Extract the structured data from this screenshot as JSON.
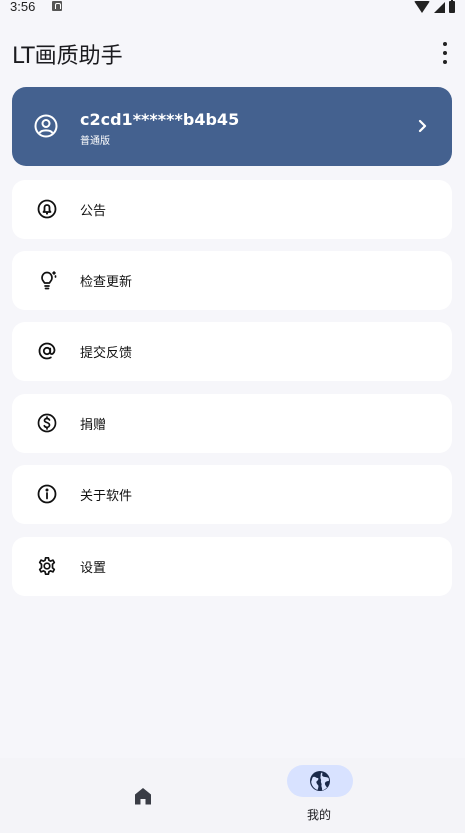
{
  "status_bar": {
    "time": "3:56"
  },
  "header": {
    "title": "LT画质助手"
  },
  "account": {
    "id": "c2cd1******b4b45",
    "tier": "普通版"
  },
  "menu": [
    {
      "label": "公告",
      "icon": "bell-icon"
    },
    {
      "label": "检查更新",
      "icon": "lightbulb-icon"
    },
    {
      "label": "提交反馈",
      "icon": "at-sign-icon"
    },
    {
      "label": "捐赠",
      "icon": "dollar-icon"
    },
    {
      "label": "关于软件",
      "icon": "info-icon"
    },
    {
      "label": "设置",
      "icon": "gear-icon"
    }
  ],
  "bottom_nav": {
    "home_icon": "home-icon",
    "mine_label": "我的",
    "mine_icon": "globe-icon"
  },
  "colors": {
    "accent": "#44618f",
    "background": "#f6f6fa",
    "card": "#ffffff",
    "nav_pill": "#d8e2ff"
  }
}
